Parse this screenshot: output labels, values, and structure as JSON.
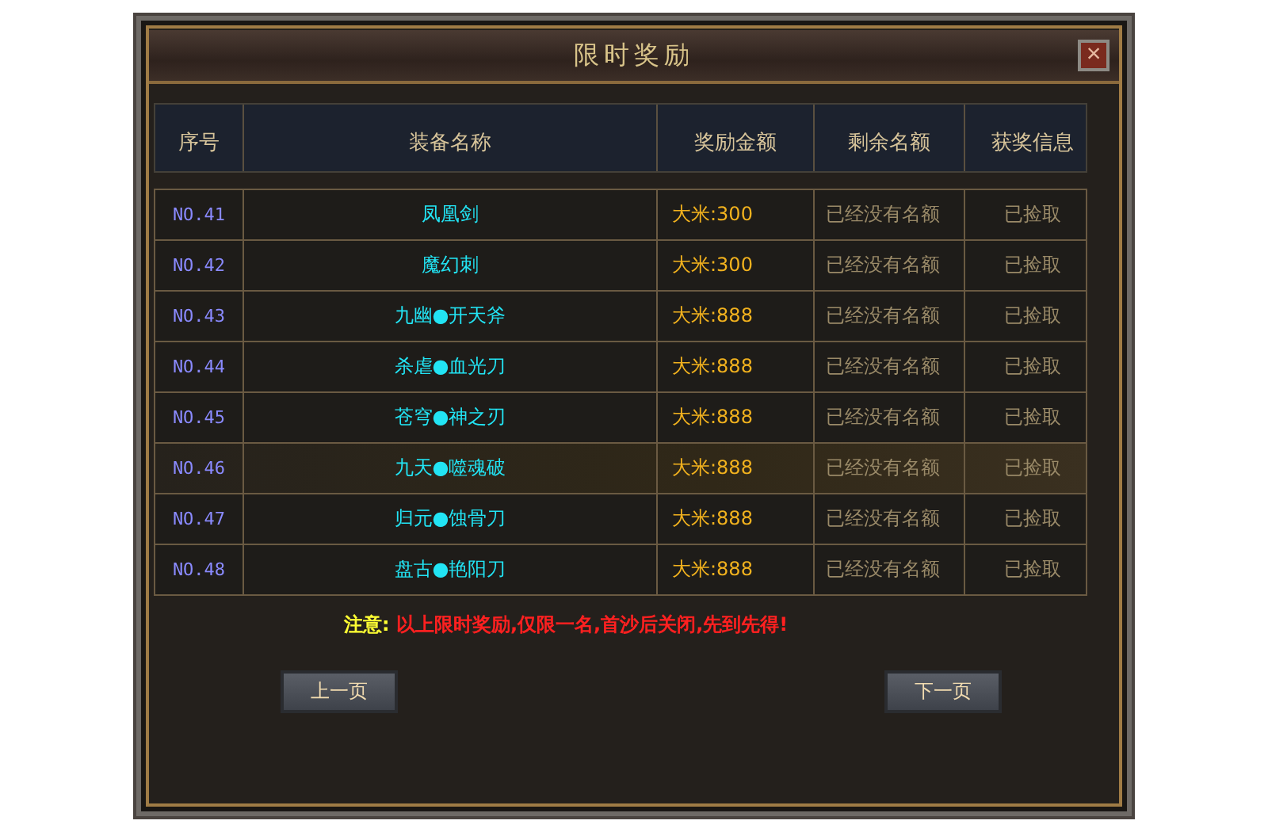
{
  "window": {
    "title": "限时奖励",
    "close": "×"
  },
  "table": {
    "columns": [
      "序号",
      "装备名称",
      "奖励金额",
      "剩余名额",
      "获奖信息"
    ],
    "rows": [
      {
        "no": "NO.41",
        "name": "凤凰剑",
        "reward": "大米:300",
        "remaining": "已经没有名额",
        "status": "已捡取",
        "selected": false
      },
      {
        "no": "NO.42",
        "name": "魔幻刺",
        "reward": "大米:300",
        "remaining": "已经没有名额",
        "status": "已捡取",
        "selected": false
      },
      {
        "no": "NO.43",
        "name": "九幽●开天斧",
        "reward": "大米:888",
        "remaining": "已经没有名额",
        "status": "已捡取",
        "selected": false
      },
      {
        "no": "NO.44",
        "name": "杀虐●血光刀",
        "reward": "大米:888",
        "remaining": "已经没有名额",
        "status": "已捡取",
        "selected": false
      },
      {
        "no": "NO.45",
        "name": "苍穹●神之刃",
        "reward": "大米:888",
        "remaining": "已经没有名额",
        "status": "已捡取",
        "selected": false
      },
      {
        "no": "NO.46",
        "name": "九天●噬魂破",
        "reward": "大米:888",
        "remaining": "已经没有名额",
        "status": "已捡取",
        "selected": true
      },
      {
        "no": "NO.47",
        "name": "归元●蚀骨刀",
        "reward": "大米:888",
        "remaining": "已经没有名额",
        "status": "已捡取",
        "selected": false
      },
      {
        "no": "NO.48",
        "name": "盘古●艳阳刀",
        "reward": "大米:888",
        "remaining": "已经没有名额",
        "status": "已捡取",
        "selected": false
      }
    ]
  },
  "notice": {
    "label": "注意:",
    "message": "以上限时奖励,仅限一名,首沙后关闭,先到先得!"
  },
  "buttons": [
    "上一页",
    "下一页"
  ]
}
